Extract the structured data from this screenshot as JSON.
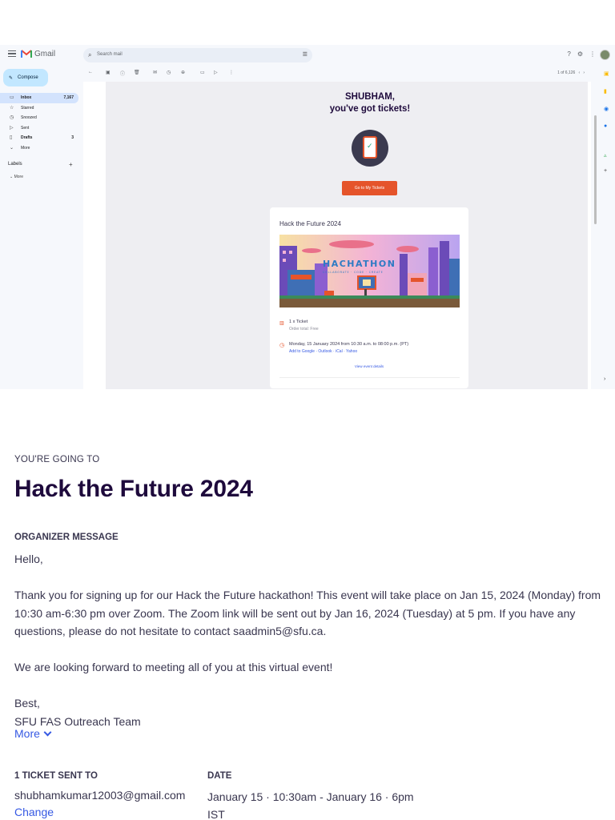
{
  "gmail": {
    "app_name": "Gmail",
    "search_placeholder": "Search mail",
    "compose_label": "Compose",
    "nav": [
      {
        "label": "Inbox",
        "count": "7,167"
      },
      {
        "label": "Starred",
        "count": ""
      },
      {
        "label": "Snoozed",
        "count": ""
      },
      {
        "label": "Sent",
        "count": ""
      },
      {
        "label": "Drafts",
        "count": "3"
      },
      {
        "label": "More",
        "count": ""
      }
    ],
    "labels_heading": "Labels",
    "labels_more": "More",
    "pager": "1 of 6,126"
  },
  "email": {
    "greeting_name": "SHUBHAM,",
    "greeting_line": "you've got tickets!",
    "cta_label": "Go to My Tickets",
    "event_name": "Hack the Future 2024",
    "banner_text": "HACHATHON",
    "banner_sub": "COLLABORATE · CODE · CREATE",
    "ticket_line": "1 x Ticket",
    "order_total": "Order total: Free",
    "date_line": "Monday, 15 January 2024 from 10:30 a.m. to 08:00 p.m. (PT)",
    "add_to": "Add to Google · Outlook · iCal · Yahoo",
    "view_details": "View event details"
  },
  "confirmation": {
    "going_label": "YOU'RE GOING TO",
    "event_title": "Hack the Future 2024",
    "organizer_heading": "ORGANIZER MESSAGE",
    "message": "Hello,\n\nThank you for signing up for our Hack the Future hackathon! This event will take place on Jan 15, 2024 (Monday) from 10:30 am-6:30 pm over Zoom. The Zoom link will be sent out by Jan 16, 2024 (Tuesday) at 5 pm. If you have any questions, please do not hesitate to contact saadmin5@sfu.ca.\n\nWe are looking forward to meeting all of you at this virtual event!\n\nBest,\nSFU FAS Outreach Team",
    "more_label": "More",
    "tickets_heading": "1 TICKET SENT TO",
    "email": "shubhamkumar12003@gmail.com",
    "change_label": "Change",
    "date_heading": "DATE",
    "date_value": "January 15 · 10:30am - January 16 · 6pm IST"
  },
  "colors": {
    "accent": "#e5542b",
    "link": "#3659e3",
    "title": "#1e0a3c"
  }
}
